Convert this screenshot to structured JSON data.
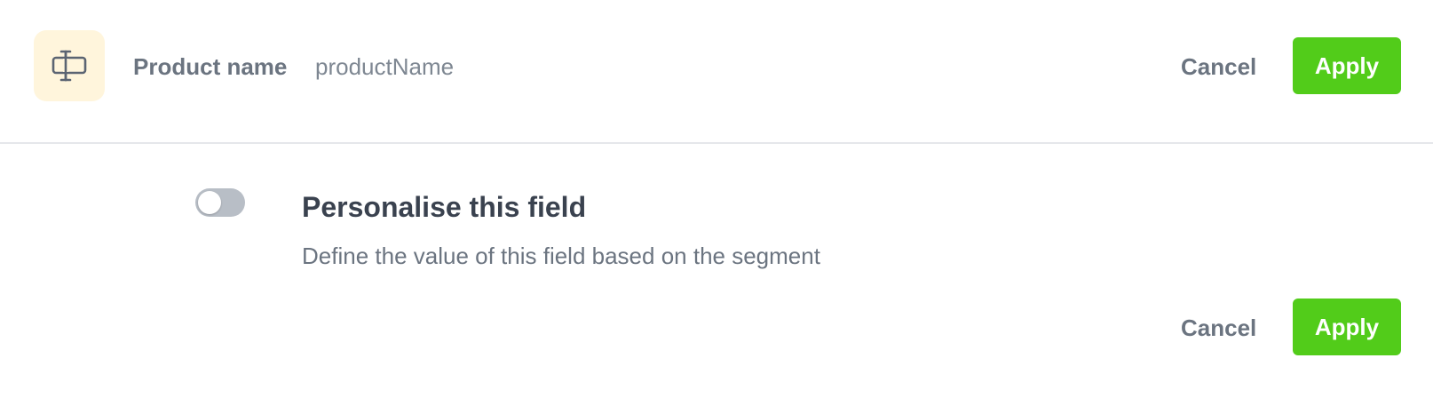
{
  "field": {
    "icon": "text-cursor-icon",
    "label": "Product name",
    "key": "productName"
  },
  "header_actions": {
    "cancel_label": "Cancel",
    "apply_label": "Apply"
  },
  "personalise": {
    "toggle_on": false,
    "title": "Personalise this field",
    "description": "Define the value of this field based on the segment"
  },
  "footer_actions": {
    "cancel_label": "Cancel",
    "apply_label": "Apply"
  },
  "colors": {
    "accent": "#52cc1a",
    "icon_bg": "#fff5dc",
    "toggle_off": "#b8bec6",
    "divider": "#e5e7eb"
  }
}
